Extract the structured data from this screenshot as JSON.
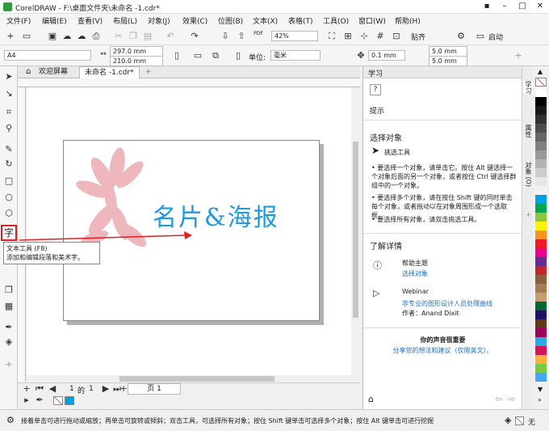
{
  "app": {
    "title": "CorelDRAW - F:\\桌面文件夹\\未命名 -1.cdr*"
  },
  "menu": [
    "文件(F)",
    "编辑(E)",
    "查看(V)",
    "布局(L)",
    "对象(J)",
    "效果(C)",
    "位图(B)",
    "文本(X)",
    "表格(T)",
    "工具(O)",
    "窗口(W)",
    "帮助(H)"
  ],
  "toolbar1": {
    "zoom": "42%",
    "paste_label": "贴齐",
    "start_label": "启动",
    "pdf": "PDF"
  },
  "toolbar2": {
    "page_size": "A4",
    "width": "297.0 mm",
    "height": "210.0 mm",
    "unit_label": "单位:",
    "unit": "毫米",
    "nudge": "0.1 mm",
    "dup_x": "5.0 mm",
    "dup_y": "5.0 mm"
  },
  "tabs": [
    "欢迎屏幕",
    "未命名 -1.cdr*"
  ],
  "canvas": {
    "poster_text": "名片&海报"
  },
  "tooltip": {
    "title": "文本工具 (F8)",
    "desc": "添加和编辑段落和美术字。"
  },
  "pagenav": {
    "current": "1",
    "of": "的",
    "total": "1",
    "page_tab": "页 1"
  },
  "docker": {
    "header": "学习",
    "hints": "提示",
    "section_title": "选择对象",
    "tool_name": "挑选工具",
    "bullets": [
      "要选择一个对象，请单击它。按住 Alt 键选择一个对象后面的另一个对象，或者按住 Ctrl 键选择群组中的一个对象。",
      "要选择多个对象，请在按住 Shift 键的同时单击每个对象，或者拖动以在对象周围形成一个选取框。",
      "要选择所有对象，请双击挑选工具。"
    ],
    "more_title": "了解详情",
    "help_title": "帮助主题",
    "help_link": "选择对象",
    "webinar_title": "Webinar",
    "webinar_link": "非专业的图形设计人员处理曲线",
    "webinar_author": "作者：Anand Dixit",
    "voice_title": "你的声音很重要",
    "voice_link": "分享您的想法和建议（仅限英文）。"
  },
  "sidetabs": [
    "学习",
    "属性",
    "对象 (O)"
  ],
  "palette": [
    "#ffffff",
    "#000000",
    "#1a1a1a",
    "#333333",
    "#4d4d4d",
    "#666666",
    "#808080",
    "#999999",
    "#b3b3b3",
    "#cccccc",
    "#e6e6e6",
    "#f2f2f2",
    "#00a0e9",
    "#00a651",
    "#8dc63f",
    "#fff200",
    "#f7941d",
    "#ed1c24",
    "#ec008c",
    "#662d91",
    "#c1272d",
    "#8b5e3c",
    "#a67c52",
    "#c69c6d",
    "#006837",
    "#1b1464",
    "#603813",
    "#9e005d",
    "#29abe2",
    "#d4145a",
    "#fbb03b",
    "#7ac943",
    "#3fa9f5"
  ],
  "status": {
    "text": "接着单击可进行拖动或缩放；再单击可旋转或倾斜；双击工具，可选择所有对象；按住 Shift 键单击可选择多个对象；按住 Alt 键单击可进行挖掘",
    "fill": "无"
  },
  "colors": {
    "accent": "#1e9be0",
    "highlight": "#e02020",
    "flower": "#e8a0a8"
  }
}
